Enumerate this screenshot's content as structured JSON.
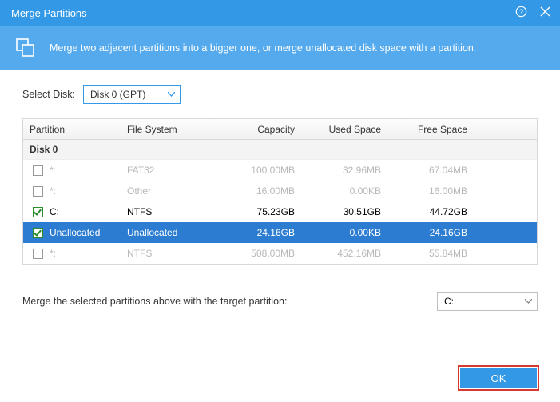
{
  "title": "Merge Partitions",
  "banner_text": "Merge two adjacent partitions into a bigger one, or merge unallocated disk space with a partition.",
  "select_disk_label": "Select Disk:",
  "disk_selected": "Disk 0 (GPT)",
  "columns": {
    "partition": "Partition",
    "fs": "File System",
    "cap": "Capacity",
    "used": "Used Space",
    "free": "Free Space"
  },
  "group_label": "Disk 0",
  "rows": [
    {
      "name": "*:",
      "fs": "FAT32",
      "cap": "100.00MB",
      "used": "32.96MB",
      "free": "67.04MB",
      "checked": false,
      "disabled": true,
      "selected": false
    },
    {
      "name": "*:",
      "fs": "Other",
      "cap": "16.00MB",
      "used": "0.00KB",
      "free": "16.00MB",
      "checked": false,
      "disabled": true,
      "selected": false
    },
    {
      "name": "C:",
      "fs": "NTFS",
      "cap": "75.23GB",
      "used": "30.51GB",
      "free": "44.72GB",
      "checked": true,
      "disabled": false,
      "selected": false
    },
    {
      "name": "Unallocated",
      "fs": "Unallocated",
      "cap": "24.16GB",
      "used": "0.00KB",
      "free": "24.16GB",
      "checked": true,
      "disabled": false,
      "selected": true
    },
    {
      "name": "*:",
      "fs": "NTFS",
      "cap": "508.00MB",
      "used": "452.16MB",
      "free": "55.84MB",
      "checked": false,
      "disabled": true,
      "selected": false
    }
  ],
  "merge_label": "Merge the selected partitions above with the target partition:",
  "target_selected": "C:",
  "ok_label": "OK"
}
